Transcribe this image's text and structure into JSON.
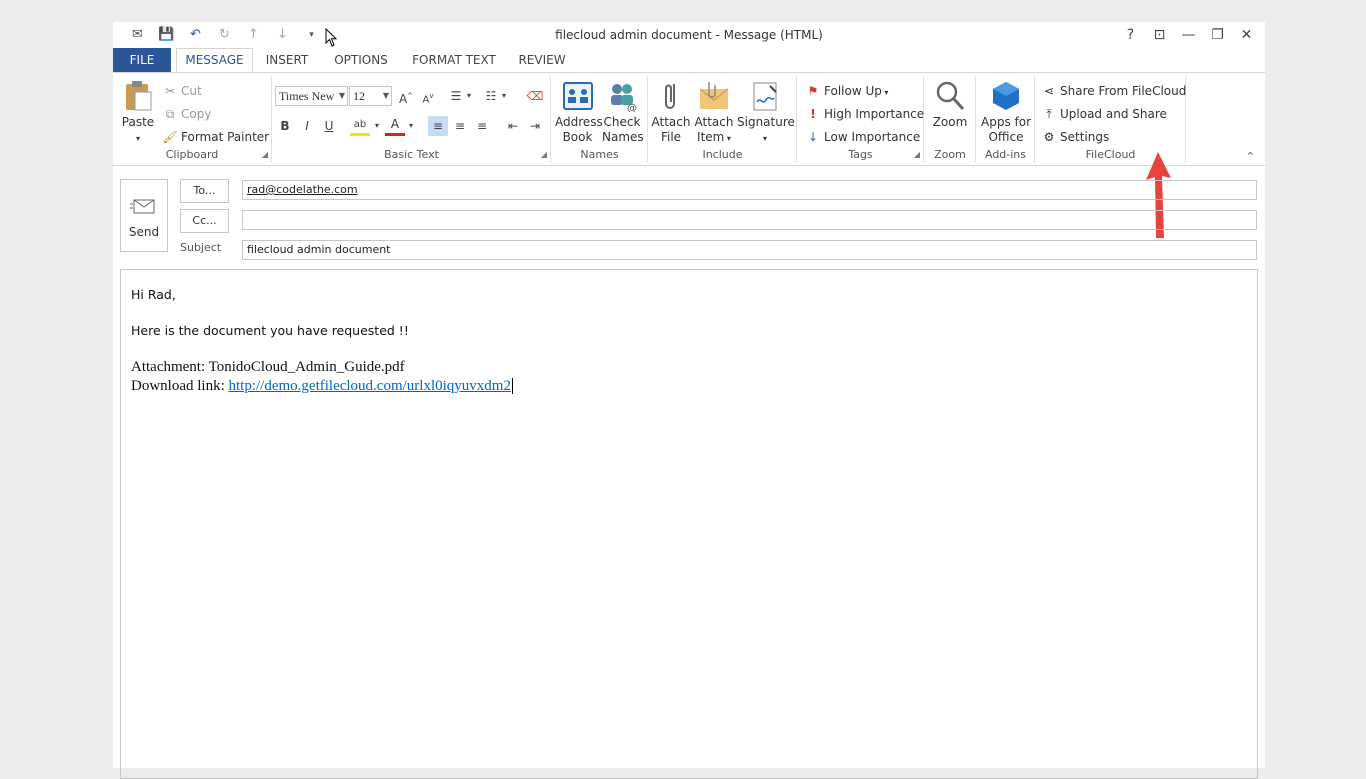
{
  "window": {
    "title": "filecloud admin document - Message (HTML)",
    "controls": [
      "?",
      "⊡",
      "—",
      "❐",
      "✕"
    ]
  },
  "qat": [
    "✉",
    "💾",
    "↶",
    "↻",
    "↑",
    "↓",
    "▾"
  ],
  "tabs": {
    "file": "FILE",
    "items": [
      "MESSAGE",
      "INSERT",
      "OPTIONS",
      "FORMAT TEXT",
      "REVIEW"
    ]
  },
  "ribbon": {
    "clipboard": {
      "label": "Clipboard",
      "paste": "Paste",
      "cut": "Cut",
      "copy": "Copy",
      "format_painter": "Format Painter"
    },
    "basic_text": {
      "label": "Basic Text",
      "font": "Times New",
      "size": "12"
    },
    "names": {
      "label": "Names",
      "address_book_1": "Address",
      "address_book_2": "Book",
      "check_names_1": "Check",
      "check_names_2": "Names"
    },
    "include": {
      "label": "Include",
      "attach_file_1": "Attach",
      "attach_file_2": "File",
      "attach_item_1": "Attach",
      "attach_item_2": "Item",
      "signature": "Signature"
    },
    "tags": {
      "label": "Tags",
      "follow_up": "Follow Up",
      "high": "High Importance",
      "low": "Low Importance"
    },
    "zoom": {
      "label": "Zoom",
      "zoom": "Zoom"
    },
    "addins": {
      "label": "Add-ins",
      "apps_1": "Apps for",
      "apps_2": "Office"
    },
    "filecloud": {
      "label": "FileCloud",
      "share": "Share From FileCloud",
      "upload": "Upload and Share",
      "settings": "Settings"
    }
  },
  "compose": {
    "send": "Send",
    "to_button": "To...",
    "cc_button": "Cc...",
    "subject_label": "Subject",
    "to_value": "rad@codelathe.com",
    "cc_value": "",
    "subject_value": "filecloud admin document"
  },
  "message": {
    "greeting": "Hi Rad,",
    "line1": "Here is the document you have requested !!",
    "attachment": "Attachment: TonidoCloud_Admin_Guide.pdf",
    "download_label": "Download link: ",
    "download_url": "http://demo.getfilecloud.com/urlxl0iqyuvxdm2"
  },
  "colors": {
    "accent": "#2b579a",
    "arrow": "#e8443f",
    "link": "#0563c1"
  }
}
